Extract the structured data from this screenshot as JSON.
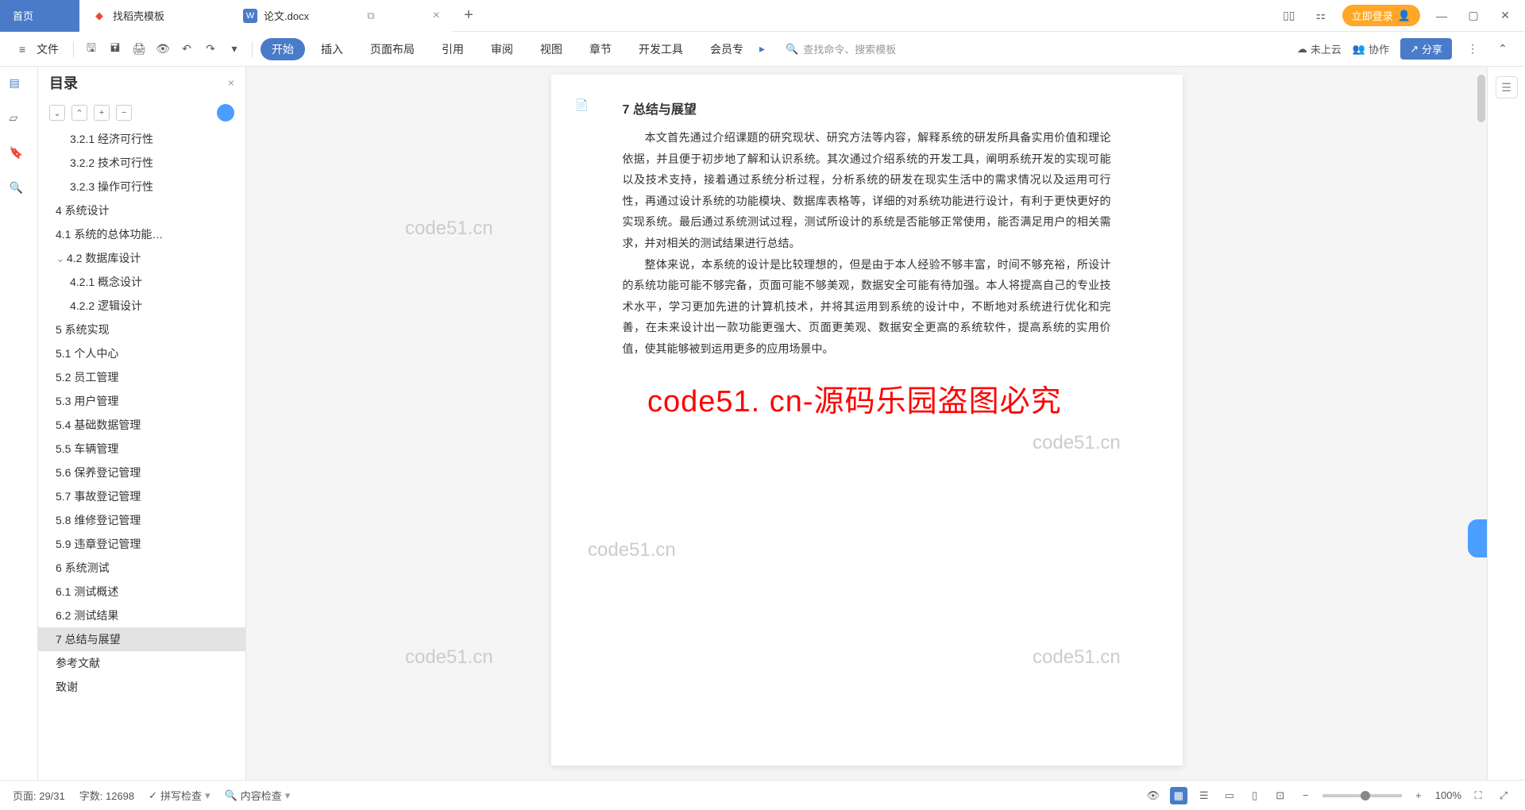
{
  "tabs": {
    "home": "首页",
    "template": "找稻壳模板",
    "doc": "论文.docx"
  },
  "titlebar": {
    "login": "立即登录"
  },
  "toolbar": {
    "file": "文件"
  },
  "ribbon": {
    "tabs": [
      "开始",
      "插入",
      "页面布局",
      "引用",
      "审阅",
      "视图",
      "章节",
      "开发工具",
      "会员专"
    ],
    "search_placeholder": "查找命令、搜索模板",
    "cloud": "未上云",
    "collab": "协作",
    "share": "分享"
  },
  "outline": {
    "title": "目录",
    "items": [
      {
        "text": "3.2.1 经济可行性",
        "level": 3
      },
      {
        "text": "3.2.2 技术可行性",
        "level": 3
      },
      {
        "text": "3.2.3 操作可行性",
        "level": 3
      },
      {
        "text": "4 系统设计",
        "level": 1
      },
      {
        "text": "4.1 系统的总体功能…",
        "level": 2
      },
      {
        "text": "4.2 数据库设计",
        "level": 2,
        "expand": true
      },
      {
        "text": "4.2.1 概念设计",
        "level": 3
      },
      {
        "text": "4.2.2 逻辑设计",
        "level": 3
      },
      {
        "text": "5 系统实现",
        "level": 1
      },
      {
        "text": "5.1 个人中心",
        "level": 2
      },
      {
        "text": "5.2 员工管理",
        "level": 2
      },
      {
        "text": "5.3 用户管理",
        "level": 2
      },
      {
        "text": "5.4 基础数据管理",
        "level": 2
      },
      {
        "text": "5.5 车辆管理",
        "level": 2
      },
      {
        "text": "5.6 保养登记管理",
        "level": 2
      },
      {
        "text": "5.7 事故登记管理",
        "level": 2
      },
      {
        "text": "5.8 维修登记管理",
        "level": 2
      },
      {
        "text": "5.9 违章登记管理",
        "level": 2
      },
      {
        "text": "6 系统测试",
        "level": 1
      },
      {
        "text": "6.1 测试概述",
        "level": 2
      },
      {
        "text": "6.2 测试结果",
        "level": 2
      },
      {
        "text": "7 总结与展望",
        "level": 1,
        "active": true
      },
      {
        "text": "参考文献",
        "level": 1
      },
      {
        "text": "致谢",
        "level": 1
      }
    ]
  },
  "document": {
    "heading": "7 总结与展望",
    "para1": "本文首先通过介绍课题的研究现状、研究方法等内容，解释系统的研发所具备实用价值和理论依据，并且便于初步地了解和认识系统。其次通过介绍系统的开发工具，阐明系统开发的实现可能以及技术支持，接着通过系统分析过程，分析系统的研发在现实生活中的需求情况以及运用可行性，再通过设计系统的功能模块、数据库表格等，详细的对系统功能进行设计，有利于更快更好的实现系统。最后通过系统测试过程，测试所设计的系统是否能够正常使用，能否满足用户的相关需求，并对相关的测试结果进行总结。",
    "para2": "整体来说，本系统的设计是比较理想的，但是由于本人经验不够丰富，时间不够充裕，所设计的系统功能可能不够完备，页面可能不够美观，数据安全可能有待加强。本人将提高自己的专业技术水平，学习更加先进的计算机技术，并将其运用到系统的设计中，不断地对系统进行优化和完善，在未来设计出一款功能更强大、页面更美观、数据安全更高的系统软件，提高系统的实用价值，使其能够被到运用更多的应用场景中。"
  },
  "watermarks": {
    "wm": "code51.cn",
    "overlay": "code51. cn-源码乐园盗图必究"
  },
  "statusbar": {
    "page": "页面: 29/31",
    "words": "字数: 12698",
    "spell": "拼写检查",
    "content": "内容检查",
    "zoom": "100%"
  }
}
